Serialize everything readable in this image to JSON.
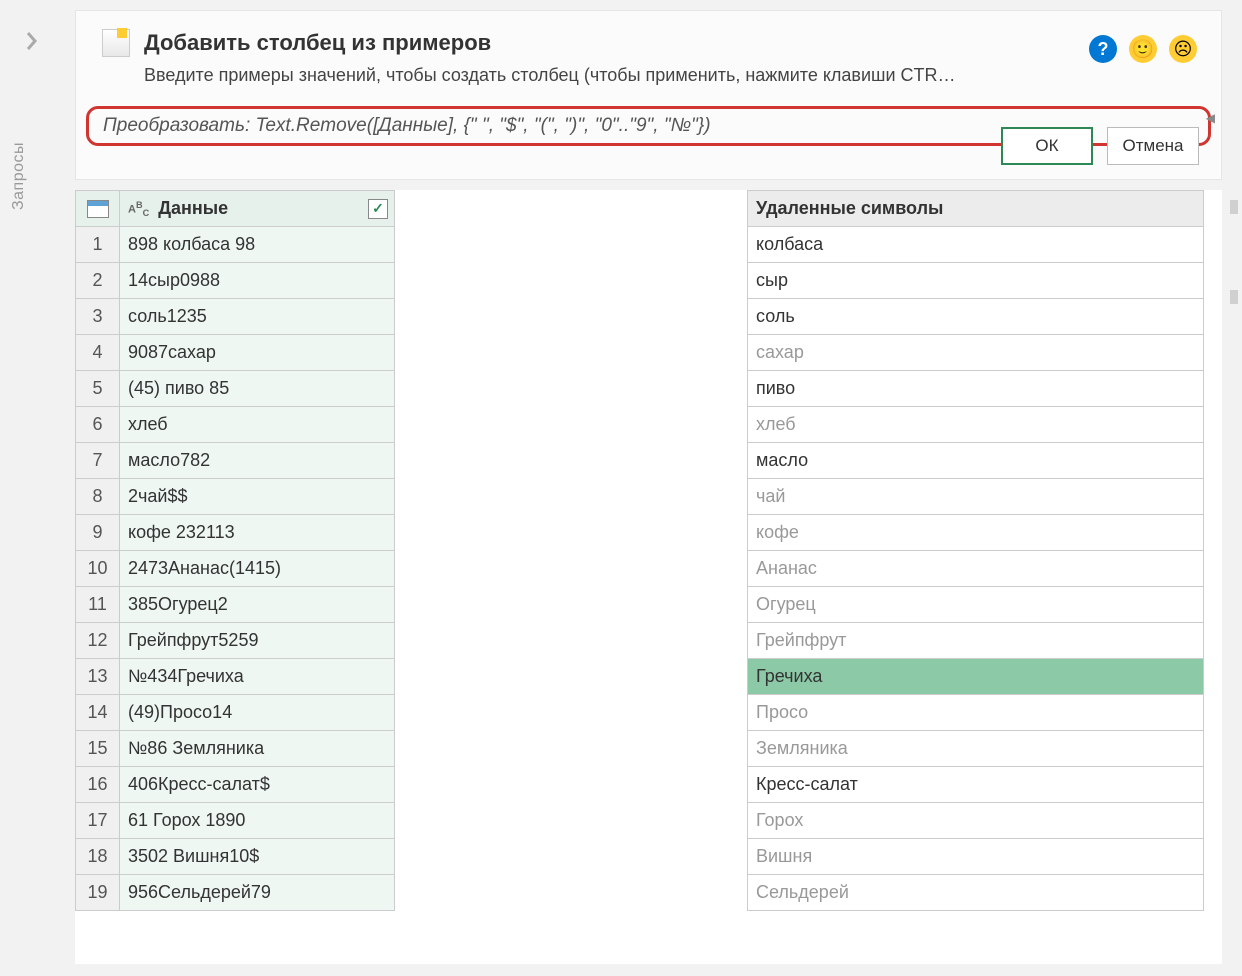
{
  "sidebar": {
    "label": "Запросы"
  },
  "panel": {
    "title": "Добавить столбец из примеров",
    "subtitle": "Введите примеры значений, чтобы создать столбец (чтобы применить, нажмите клавиши CTR…",
    "formula": "Преобразовать: Text.Remove([Данные], {\" \", \"$\", \"(\", \")\", \"0\"..\"9\", \"№\"})",
    "ok_label": "ОК",
    "cancel_label": "Отмена"
  },
  "source": {
    "header": "Данные",
    "rows": [
      "898 колбаса 98",
      "14сыр0988",
      "соль1235",
      "9087сахар",
      "(45) пиво 85",
      "хлеб",
      "масло782",
      "2чай$$",
      "кофе 232113",
      "2473Ананас(1415)",
      "385Огурец2",
      "Грейпфрут5259",
      "№434Гречиха",
      "(49)Просо14",
      "№86 Земляника",
      "406Кресс-салат$",
      "61 Горох 1890",
      "3502 Вишня10$",
      "956Сельдерей79"
    ]
  },
  "result": {
    "header": "Удаленные символы",
    "rows": [
      {
        "v": "колбаса",
        "user": true
      },
      {
        "v": "сыр",
        "user": true
      },
      {
        "v": "соль",
        "user": true
      },
      {
        "v": "сахар",
        "user": false
      },
      {
        "v": "пиво",
        "user": true
      },
      {
        "v": "хлеб",
        "user": false
      },
      {
        "v": "масло",
        "user": true
      },
      {
        "v": "чай",
        "user": false
      },
      {
        "v": "кофе",
        "user": false
      },
      {
        "v": "Ананас",
        "user": false
      },
      {
        "v": "Огурец",
        "user": false
      },
      {
        "v": "Грейпфрут",
        "user": false
      },
      {
        "v": "Гречиха",
        "user": false,
        "sel": true
      },
      {
        "v": "Просо",
        "user": false
      },
      {
        "v": "Земляника",
        "user": false
      },
      {
        "v": "Кресс-салат",
        "user": true
      },
      {
        "v": "Горох",
        "user": false
      },
      {
        "v": "Вишня",
        "user": false
      },
      {
        "v": "Сельдерей",
        "user": false
      }
    ]
  }
}
